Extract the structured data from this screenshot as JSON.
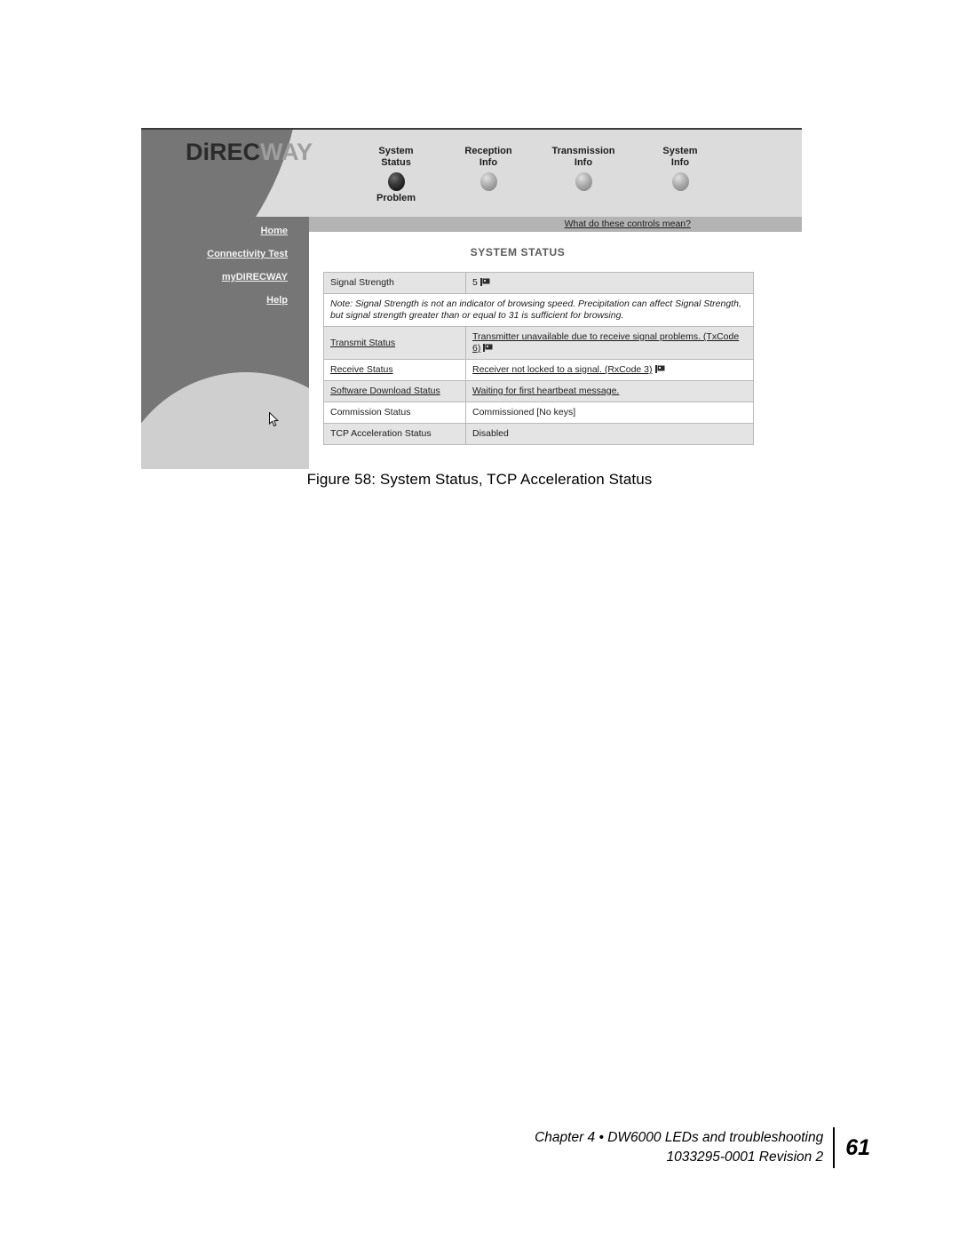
{
  "screenshot": {
    "banner": {
      "logo_dark": "DiREC",
      "logo_light": "WAY",
      "leds": [
        {
          "label_line1": "System",
          "label_line2": "Status",
          "state": "Problem",
          "lit": "off",
          "icon": "led-indicator"
        },
        {
          "label_line1": "Reception",
          "label_line2": "Info",
          "state": "",
          "lit": "on",
          "icon": "led-indicator"
        },
        {
          "label_line1": "Transmission",
          "label_line2": "Info",
          "state": "",
          "lit": "on",
          "icon": "led-indicator"
        },
        {
          "label_line1": "System",
          "label_line2": "Info",
          "state": "",
          "lit": "on",
          "icon": "led-indicator"
        }
      ]
    },
    "controls_bar": {
      "link": "What do these controls mean?"
    },
    "sidebar": {
      "items": [
        {
          "label": "Home"
        },
        {
          "label": "Connectivity Test"
        },
        {
          "label": "myDIRECWAY"
        },
        {
          "label": "Help"
        }
      ],
      "cursor_icon": "mouse-pointer-icon"
    },
    "content": {
      "page_title": "SYSTEM STATUS",
      "rows": [
        {
          "type": "data",
          "key": "Signal Strength",
          "key_link": false,
          "value": "5",
          "value_link": false,
          "flag": true,
          "shade": "gray"
        },
        {
          "type": "note",
          "text": "Note: Signal Strength is not an indicator of browsing speed. Precipitation can affect Signal Strength, but signal strength greater than or equal to 31 is sufficient for browsing."
        },
        {
          "type": "data",
          "key": "Transmit Status",
          "key_link": true,
          "value": "Transmitter unavailable due to receive signal problems. (TxCode 6)",
          "value_link": true,
          "flag": true,
          "shade": "gray"
        },
        {
          "type": "data",
          "key": "Receive Status",
          "key_link": true,
          "value": "Receiver not locked to a signal. (RxCode 3)",
          "value_link": true,
          "flag": true,
          "shade": "white"
        },
        {
          "type": "data",
          "key": "Software Download Status",
          "key_link": true,
          "value": "Waiting for first heartbeat message.",
          "value_link": true,
          "flag": false,
          "shade": "gray"
        },
        {
          "type": "data",
          "key": "Commission Status",
          "key_link": false,
          "value": "Commissioned [No keys]",
          "value_link": false,
          "flag": false,
          "shade": "white"
        },
        {
          "type": "data",
          "key": "TCP Acceleration Status",
          "key_link": false,
          "value": "Disabled",
          "value_link": false,
          "flag": false,
          "shade": "gray"
        }
      ]
    }
  },
  "caption": "Figure 58:  System Status, TCP Acceleration Status",
  "footer": {
    "line1": "Chapter 4 • DW6000 LEDs and troubleshooting",
    "line2": "1033295-0001  Revision 2",
    "page_number": "61"
  }
}
